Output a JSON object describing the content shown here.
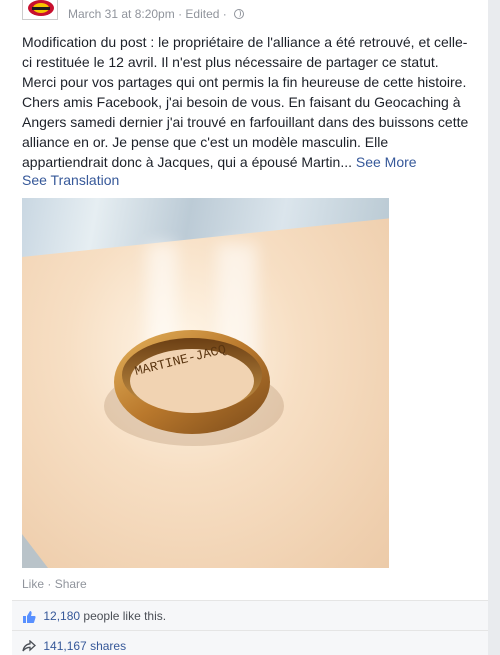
{
  "post": {
    "timestamp": "March 31 at 8:20pm",
    "separator": "·",
    "edited": "Edited",
    "paragraph1": "Modification du post : le propriétaire de l'alliance a été retrouvé, et celle-ci restituée le 12 avril. Il n'est plus nécessaire de partager ce statut. Merci pour vos partages qui ont permis la fin heureuse de cette histoire.",
    "paragraph2": "Chers amis Facebook, j'ai besoin de vous. En faisant du Geocaching à Angers samedi dernier j'ai trouvé en farfouillant dans des buissons cette alliance en or. Je pense que c'est un modèle masculin. Elle appartiendrait donc à Jacques, qui a épousé Martin...",
    "see_more": "See More",
    "see_translation": "See Translation",
    "photo_engraving": "MARTINE-JACQ"
  },
  "actions": {
    "like": "Like",
    "separator": "·",
    "share": "Share"
  },
  "stats": {
    "likes_count": "12,180",
    "likes_suffix": "people like this.",
    "shares_count": "141,167",
    "shares_suffix": "shares"
  },
  "colors": {
    "link": "#365899",
    "meta": "#90949c",
    "text": "#1d2129"
  }
}
